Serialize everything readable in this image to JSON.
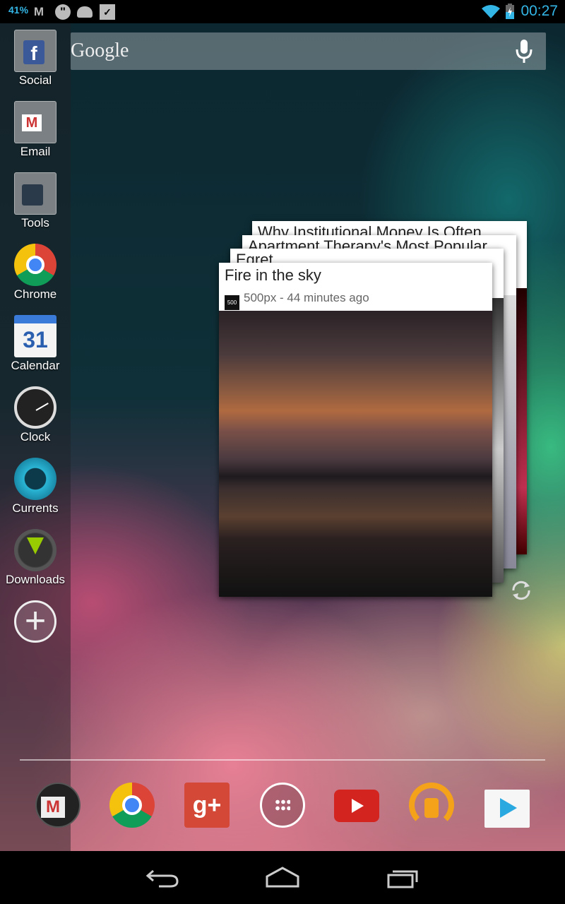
{
  "status_bar": {
    "battery_percent": "41%",
    "time": "00:27",
    "notification_icons": [
      "gmail-icon",
      "hangouts-icon",
      "android-icon",
      "play-store-icon"
    ],
    "system_icons": [
      "wifi-icon",
      "battery-charging-icon"
    ]
  },
  "search": {
    "logo_text": "Google",
    "mic": "mic-icon"
  },
  "sidebar": {
    "items": [
      {
        "label": "Social",
        "icon": "social-folder-icon"
      },
      {
        "label": "Email",
        "icon": "email-folder-icon"
      },
      {
        "label": "Tools",
        "icon": "tools-folder-icon"
      },
      {
        "label": "Chrome",
        "icon": "chrome-icon"
      },
      {
        "label": "Calendar",
        "icon": "calendar-icon",
        "day": "31"
      },
      {
        "label": "Clock",
        "icon": "clock-icon"
      },
      {
        "label": "Currents",
        "icon": "currents-icon"
      },
      {
        "label": "Downloads",
        "icon": "downloads-icon"
      },
      {
        "label": "",
        "icon": "add-icon"
      }
    ]
  },
  "currents_widget": {
    "cards": [
      {
        "title": "Why Institutional Money Is Often"
      },
      {
        "title": "Apartment Therapy's Most Popular"
      },
      {
        "title": "Egret"
      },
      {
        "title": "Fire in the sky",
        "source": "500px - 44 minutes ago",
        "source_logo": "500"
      }
    ],
    "refresh": "refresh-icon"
  },
  "dock": [
    "gmail-folder-icon",
    "chrome-icon",
    "google-plus-icon",
    "all-apps-icon",
    "youtube-icon",
    "play-music-icon",
    "play-store-icon"
  ],
  "nav": [
    "back-icon",
    "home-icon",
    "recents-icon"
  ],
  "colors": {
    "accent": "#33b5e5"
  }
}
